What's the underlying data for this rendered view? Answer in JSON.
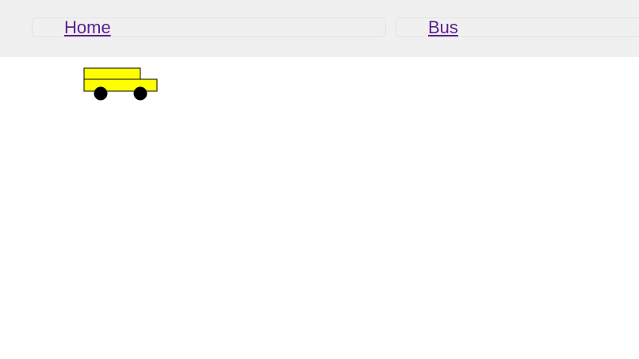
{
  "nav": {
    "items": [
      {
        "label": "Home"
      },
      {
        "label": "Bus"
      }
    ]
  },
  "colors": {
    "nav_background": "#f0f0f0",
    "link": "#5a1f8c",
    "bus_body": "#ffff00",
    "bus_wheel": "#000000"
  },
  "icons": {
    "bus": "bus-icon"
  }
}
